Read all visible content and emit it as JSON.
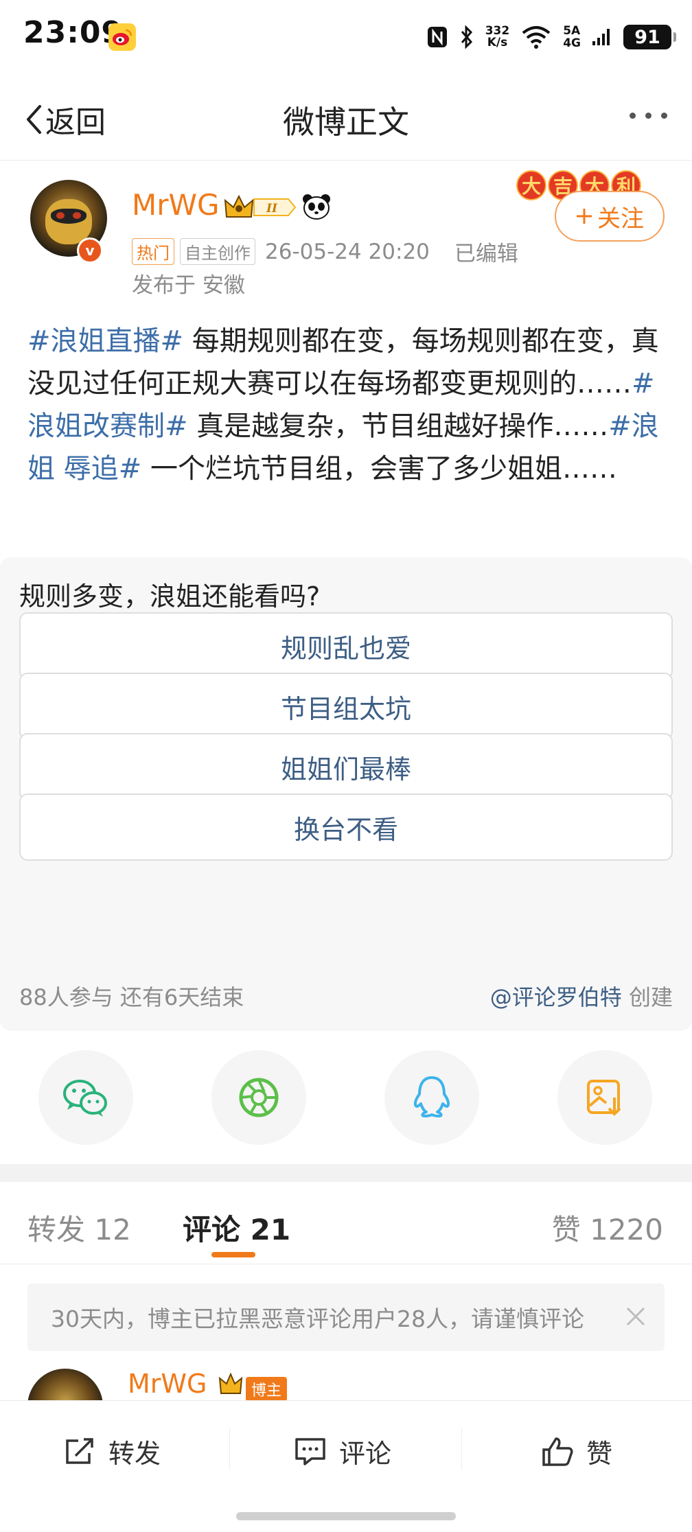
{
  "status_bar": {
    "time": "23:09",
    "speed_value": "332",
    "speed_unit": "K/s",
    "net_top": "5A",
    "net_bottom": "4G",
    "battery": "91"
  },
  "nav": {
    "back_label": "返回",
    "title": "微博正文"
  },
  "author": {
    "name": "MrWG",
    "level": "II",
    "tag_hot": "热门",
    "tag_origin": "自主创作",
    "time": "26-05-24 20:20",
    "edited": "已编辑",
    "location": "发布于 安徽",
    "festive": [
      "大",
      "吉",
      "大",
      "利"
    ],
    "follow_label": "关注",
    "verified_mark": "v"
  },
  "post": {
    "segments": [
      {
        "type": "hashtag",
        "text": "#浪姐直播#"
      },
      {
        "type": "text",
        "text": " 每期规则都在变，每场规则都在变，真没见过任何正规大赛可以在每场都变更规则的……"
      },
      {
        "type": "hashtag",
        "text": "#浪姐改赛制#"
      },
      {
        "type": "text",
        "text": " 真是越复杂，节目组越好操作……"
      },
      {
        "type": "hashtag",
        "text": "#浪姐 辱追#"
      },
      {
        "type": "text",
        "text": " 一个烂坑节目组，会害了多少姐姐……"
      }
    ]
  },
  "poll": {
    "question": "规则多变，浪姐还能看吗?",
    "options": [
      "规则乱也爱",
      "节目组太坑",
      "姐姐们最棒",
      "换台不看"
    ],
    "participants": "88人参与",
    "remaining": "还有6天结束",
    "creator": "@评论罗伯特",
    "creator_suffix": "创建"
  },
  "share": [
    "wechat-icon",
    "moments-icon",
    "qq-icon",
    "save-image-icon"
  ],
  "tabs": {
    "repost": "转发 12",
    "comment": "评论 21",
    "like": "赞 1220"
  },
  "notice": {
    "text": "30天内，博主已拉黑恶意评论用户28人，请谨慎评论"
  },
  "comment_preview": {
    "name": "MrWG",
    "tag": "博主"
  },
  "bottom_bar": {
    "repost": "转发",
    "comment": "评论",
    "like": "赞"
  },
  "colors": {
    "accent": "#f07a1a",
    "link": "#3d6ea8",
    "poll_text": "#3d5e84"
  }
}
